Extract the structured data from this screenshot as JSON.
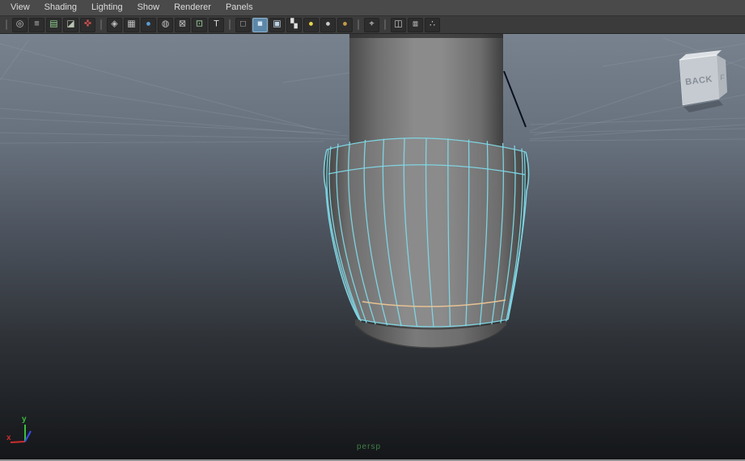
{
  "menubar": {
    "items": [
      {
        "label": "View"
      },
      {
        "label": "Shading"
      },
      {
        "label": "Lighting"
      },
      {
        "label": "Show"
      },
      {
        "label": "Renderer"
      },
      {
        "label": "Panels"
      }
    ]
  },
  "toolbar": {
    "active_bg": "#5d87a8",
    "groups": [
      {
        "icons": [
          {
            "name": "select-camera-icon",
            "glyph": "◎",
            "fg": "#c8c8c8"
          },
          {
            "name": "camera-attributes-icon",
            "glyph": "≡",
            "fg": "#c8c8c8"
          },
          {
            "name": "bookmarks-icon",
            "glyph": "▤",
            "fg": "#8fd08f"
          },
          {
            "name": "image-plane-icon",
            "glyph": "◪",
            "fg": "#b9c4b2"
          },
          {
            "name": "2d-pan-zoom-icon",
            "glyph": "✜",
            "fg": "#e05050"
          }
        ]
      },
      {
        "icons": [
          {
            "name": "film-gate-icon",
            "glyph": "◈",
            "fg": "#c0c0c0"
          },
          {
            "name": "resolution-gate-icon",
            "glyph": "▦",
            "fg": "#c0c0c0"
          },
          {
            "name": "gate-mask-icon",
            "glyph": "●",
            "fg": "#5b9bd5"
          },
          {
            "name": "field-chart-icon",
            "glyph": "◍",
            "fg": "#c0c0c0"
          },
          {
            "name": "safe-action-icon",
            "glyph": "⊠",
            "fg": "#c0c0c0"
          },
          {
            "name": "film-pivot-icon",
            "glyph": "⊡",
            "fg": "#9fd49f"
          },
          {
            "name": "safe-title-icon",
            "glyph": "T",
            "fg": "#d8d8d8"
          }
        ]
      },
      {
        "icons": [
          {
            "name": "wireframe-icon",
            "glyph": "□",
            "fg": "#c9c9c9"
          },
          {
            "name": "smooth-shade-icon",
            "glyph": "■",
            "fg": "#cfe3f2",
            "active": true
          },
          {
            "name": "textured-icon",
            "glyph": "▣",
            "fg": "#bcd3e2"
          },
          {
            "name": "use-default-material-icon",
            "glyph": "▚",
            "fg": "#e0e0e0"
          },
          {
            "name": "use-all-lights-icon",
            "glyph": "●",
            "fg": "#e8d44c"
          },
          {
            "name": "shadows-icon",
            "glyph": "●",
            "fg": "#c9c9c9"
          },
          {
            "name": "ambient-occlusion-icon",
            "glyph": "●",
            "fg": "#c79a4a"
          }
        ]
      },
      {
        "icons": [
          {
            "name": "isolate-select-icon",
            "glyph": "⌖",
            "fg": "#d0d0d0"
          }
        ]
      },
      {
        "icons": [
          {
            "name": "xray-icon",
            "glyph": "◫",
            "fg": "#c9c9c9"
          },
          {
            "name": "wireframe-on-shaded-icon",
            "glyph": "⧈",
            "fg": "#c9c9c9"
          },
          {
            "name": "node-connections-icon",
            "glyph": "∴",
            "fg": "#c9c9c9"
          }
        ]
      }
    ]
  },
  "viewport": {
    "camera_label": "persp",
    "camera_label_color": "#3d7f46",
    "grid_color": "#98a3ae",
    "background": {
      "top": "#78828e",
      "upper": "#67717d",
      "mid": "#4e5560",
      "lower": "#2e3237",
      "bottom": "#141619"
    },
    "view_cube": {
      "front_label": "BACK",
      "side_label": "F",
      "face_color": "#c6cbd1",
      "side_color": "#b0b6bc",
      "top_color": "#dde1e5",
      "label_color": "#878e97"
    },
    "axis_indicator": {
      "x_label": "x",
      "y_label": "y",
      "x_color": "#cc2d2d",
      "y_color": "#3dbd3d",
      "z_color": "#3a4bee"
    },
    "model": {
      "visible_vertical_edges": 14,
      "selected_edge_color": "#7fd9e8",
      "highlighted_edge_color": "#e6c395",
      "curve_color": "#0b1020",
      "surface_edge": "#3f3f3f",
      "surface_mid": "#6e6e6e",
      "surface_light": "#8b8b8b",
      "base_dark": "#454545",
      "base_light": "#7a7a7a"
    }
  },
  "window": {
    "bottom_border_color": "#929292"
  }
}
